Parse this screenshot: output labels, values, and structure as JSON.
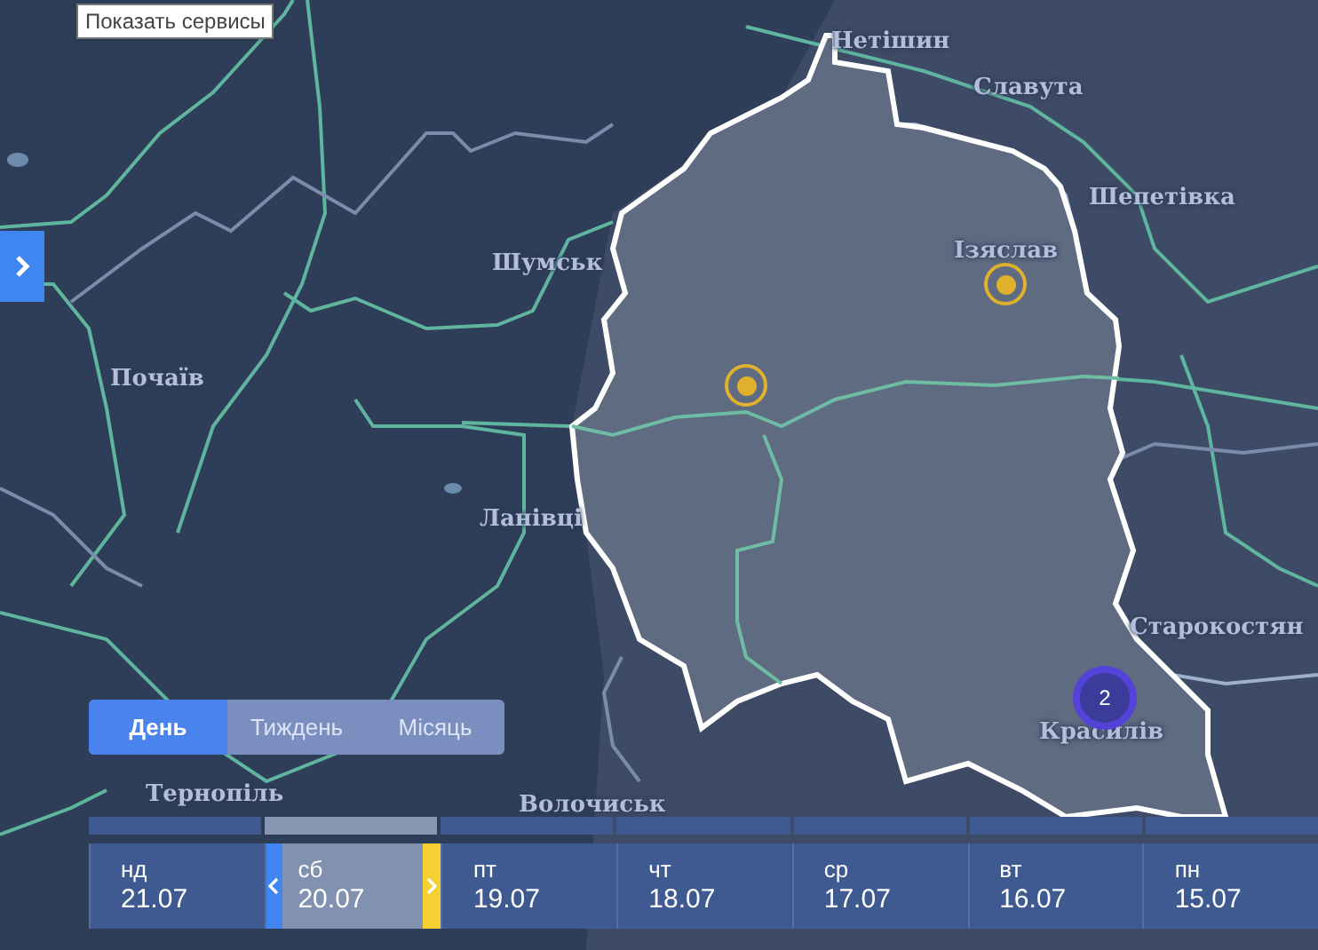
{
  "tooltip": "Показать сервисы",
  "map_labels": [
    {
      "text": "Нетішин"
    },
    {
      "text": "Славута"
    },
    {
      "text": "Шепетівка"
    },
    {
      "text": "Шумськ"
    },
    {
      "text": "Ізяслав"
    },
    {
      "text": "Почаїв"
    },
    {
      "text": "Ланівці"
    },
    {
      "text": "Старокостян"
    },
    {
      "text": "Красилів"
    },
    {
      "text": "Тернопіль"
    },
    {
      "text": "Волочиськ"
    }
  ],
  "markers": [
    {
      "kind": "point"
    },
    {
      "kind": "point"
    },
    {
      "kind": "cluster",
      "count": "2"
    }
  ],
  "period_tabs": [
    {
      "label": "День",
      "selected": true
    },
    {
      "label": "Тиждень",
      "selected": false
    },
    {
      "label": "Місяць",
      "selected": false
    }
  ],
  "days": [
    {
      "weekday": "нд",
      "date": "21.07",
      "selected": false
    },
    {
      "weekday": "сб",
      "date": "20.07",
      "selected": true
    },
    {
      "weekday": "пт",
      "date": "19.07",
      "selected": false
    },
    {
      "weekday": "чт",
      "date": "18.07",
      "selected": false
    },
    {
      "weekday": "ср",
      "date": "17.07",
      "selected": false
    },
    {
      "weekday": "вт",
      "date": "16.07",
      "selected": false
    },
    {
      "weekday": "пн",
      "date": "15.07",
      "selected": false
    }
  ]
}
